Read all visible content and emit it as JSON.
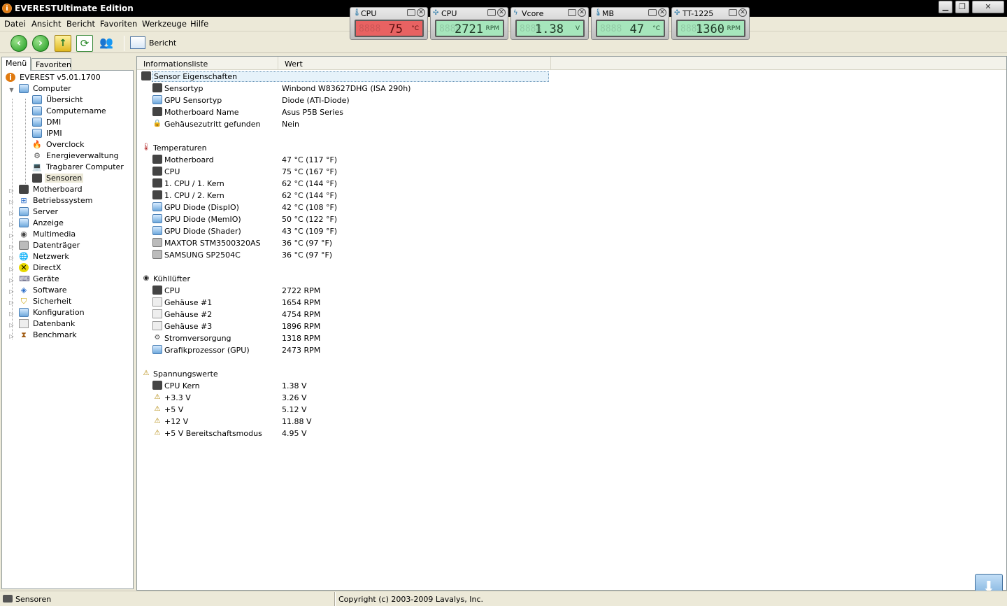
{
  "window": {
    "title": "EVERESTUltimate Edition"
  },
  "menu": [
    "Datei",
    "Ansicht",
    "Bericht",
    "Favoriten",
    "Werkzeuge",
    "Hilfe"
  ],
  "toolbar": {
    "report_label": "Bericht"
  },
  "gadgets": [
    {
      "title": "CPU",
      "value": "75",
      "unit": "°C",
      "alert": true
    },
    {
      "title": "CPU",
      "value": "2721",
      "unit": "RPM",
      "alert": false
    },
    {
      "title": "Vcore",
      "value": "1.38",
      "unit": "V",
      "alert": false
    },
    {
      "title": "MB",
      "value": "47",
      "unit": "°C",
      "alert": false
    },
    {
      "title": "TT-1225",
      "value": "1360",
      "unit": "RPM",
      "alert": false
    }
  ],
  "tabs": {
    "menu": "Menü",
    "favorites": "Favoriten"
  },
  "tree": {
    "root": "EVERESТ v5.01.1700",
    "computer": "Computer",
    "computer_children": [
      "Übersicht",
      "Computername",
      "DMI",
      "IPMI",
      "Overclock",
      "Energieverwaltung",
      "Tragbarer Computer",
      "Sensoren"
    ],
    "categories": [
      "Motherboard",
      "Betriebssystem",
      "Server",
      "Anzeige",
      "Multimedia",
      "Datenträger",
      "Netzwerk",
      "DirectX",
      "Geräte",
      "Software",
      "Sicherheit",
      "Konfiguration",
      "Datenbank",
      "Benchmark"
    ]
  },
  "columns": {
    "col1": "Informationsliste",
    "col2": "Wert"
  },
  "sections": {
    "props": {
      "title": "Sensor Eigenschaften",
      "rows": [
        {
          "label": "Sensortyp",
          "value": "Winbond W83627DHG  (ISA 290h)"
        },
        {
          "label": "GPU Sensortyp",
          "value": "Diode  (ATI-Diode)"
        },
        {
          "label": "Motherboard Name",
          "value": "Asus P5B Series"
        },
        {
          "label": "Gehäusezutritt gefunden",
          "value": "Nein"
        }
      ]
    },
    "temps": {
      "title": "Temperaturen",
      "rows": [
        {
          "label": "Motherboard",
          "value": "47 °C  (117 °F)"
        },
        {
          "label": "CPU",
          "value": "75 °C  (167 °F)"
        },
        {
          "label": "1. CPU / 1. Kern",
          "value": "62 °C  (144 °F)"
        },
        {
          "label": "1. CPU / 2. Kern",
          "value": "62 °C  (144 °F)"
        },
        {
          "label": "GPU Diode (DispIO)",
          "value": "42 °C  (108 °F)"
        },
        {
          "label": "GPU Diode (MemIO)",
          "value": "50 °C  (122 °F)"
        },
        {
          "label": "GPU Diode (Shader)",
          "value": "43 °C  (109 °F)"
        },
        {
          "label": "MAXTOR STM3500320AS",
          "value": "36 °C  (97 °F)"
        },
        {
          "label": "SAMSUNG SP2504C",
          "value": "36 °C  (97 °F)"
        }
      ]
    },
    "fans": {
      "title": "Kühllüfter",
      "rows": [
        {
          "label": "CPU",
          "value": "2722 RPM"
        },
        {
          "label": "Gehäuse #1",
          "value": "1654 RPM"
        },
        {
          "label": "Gehäuse #2",
          "value": "4754 RPM"
        },
        {
          "label": "Gehäuse #3",
          "value": "1896 RPM"
        },
        {
          "label": "Stromversorgung",
          "value": "1318 RPM"
        },
        {
          "label": "Grafikprozessor (GPU)",
          "value": "2473 RPM"
        }
      ]
    },
    "volts": {
      "title": "Spannungswerte",
      "rows": [
        {
          "label": "CPU Kern",
          "value": "1.38 V"
        },
        {
          "label": "+3.3 V",
          "value": "3.26 V"
        },
        {
          "label": "+5 V",
          "value": "5.12 V"
        },
        {
          "label": "+12 V",
          "value": "11.88 V"
        },
        {
          "label": "+5 V Bereitschaftsmodus",
          "value": "4.95 V"
        }
      ]
    }
  },
  "status": {
    "left": "Sensoren",
    "right": "Copyright (c) 2003-2009 Lavalys, Inc."
  }
}
